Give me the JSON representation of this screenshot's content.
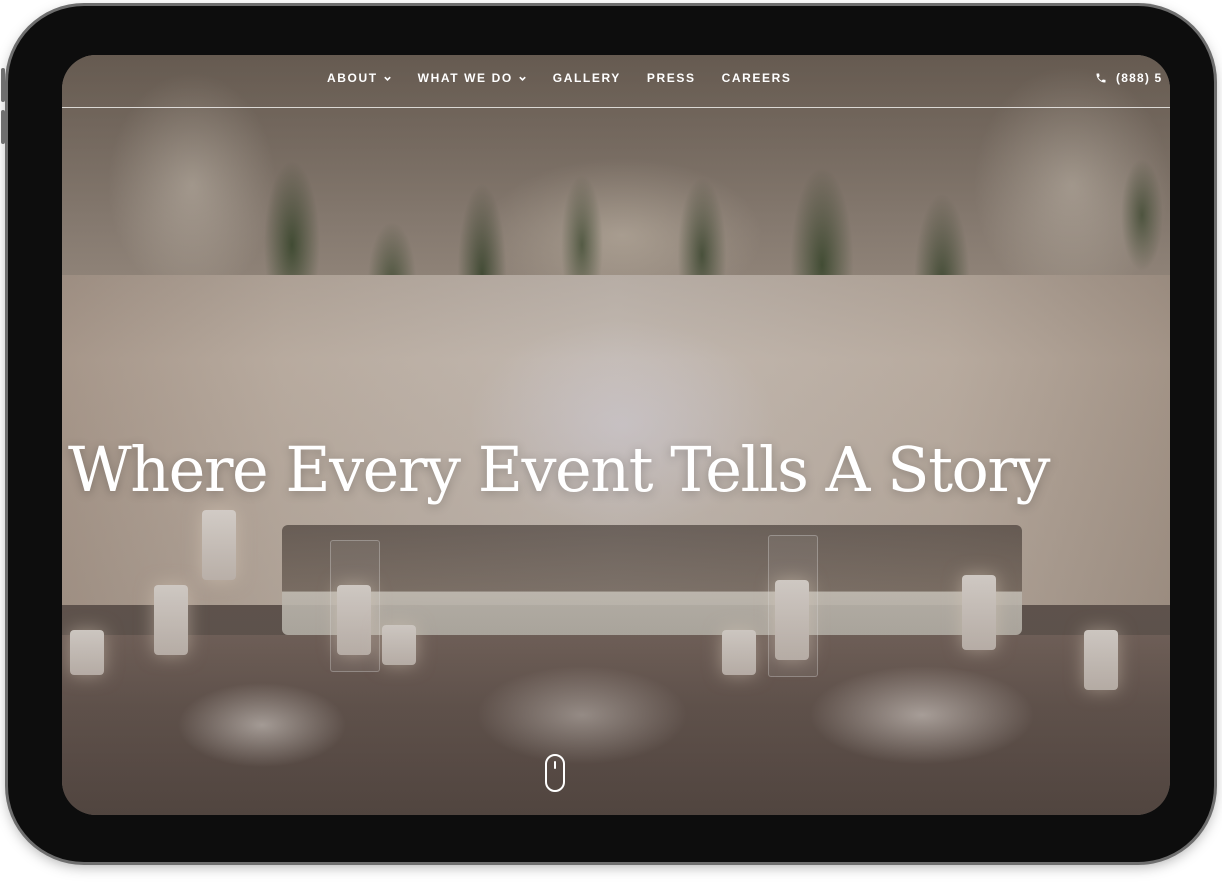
{
  "nav": {
    "items": [
      {
        "label": "ABOUT",
        "has_dropdown": true
      },
      {
        "label": "WHAT WE DO",
        "has_dropdown": true
      },
      {
        "label": "GALLERY",
        "has_dropdown": false
      },
      {
        "label": "PRESS",
        "has_dropdown": false
      },
      {
        "label": "CAREERS",
        "has_dropdown": false
      }
    ],
    "phone_text": "(888) 5",
    "phone_icon": "phone-icon",
    "dropdown_icon": "chevron-down-icon"
  },
  "hero": {
    "headline": "Where Every Event Tells A Story",
    "scroll_icon": "mouse-scroll-icon",
    "text_color": "#ffffff"
  },
  "device": {
    "frame_color": "#0d0d0d",
    "bezel_color": "#6e6e6e"
  }
}
